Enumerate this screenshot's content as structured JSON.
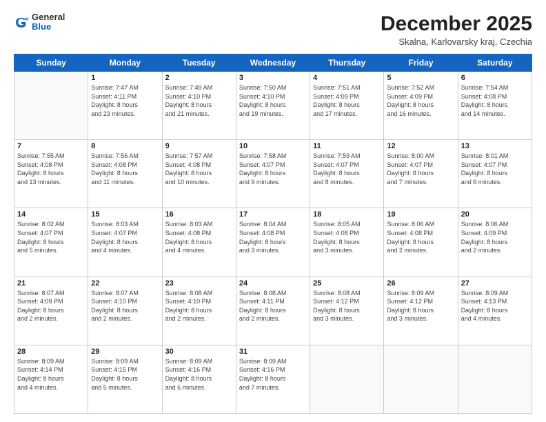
{
  "logo": {
    "general": "General",
    "blue": "Blue"
  },
  "header": {
    "title": "December 2025",
    "subtitle": "Skalna, Karlovarsky kraj, Czechia"
  },
  "days_of_week": [
    "Sunday",
    "Monday",
    "Tuesday",
    "Wednesday",
    "Thursday",
    "Friday",
    "Saturday"
  ],
  "weeks": [
    [
      {
        "day": "",
        "info": ""
      },
      {
        "day": "1",
        "info": "Sunrise: 7:47 AM\nSunset: 4:11 PM\nDaylight: 8 hours\nand 23 minutes."
      },
      {
        "day": "2",
        "info": "Sunrise: 7:49 AM\nSunset: 4:10 PM\nDaylight: 8 hours\nand 21 minutes."
      },
      {
        "day": "3",
        "info": "Sunrise: 7:50 AM\nSunset: 4:10 PM\nDaylight: 8 hours\nand 19 minutes."
      },
      {
        "day": "4",
        "info": "Sunrise: 7:51 AM\nSunset: 4:09 PM\nDaylight: 8 hours\nand 17 minutes."
      },
      {
        "day": "5",
        "info": "Sunrise: 7:52 AM\nSunset: 4:09 PM\nDaylight: 8 hours\nand 16 minutes."
      },
      {
        "day": "6",
        "info": "Sunrise: 7:54 AM\nSunset: 4:08 PM\nDaylight: 8 hours\nand 14 minutes."
      }
    ],
    [
      {
        "day": "7",
        "info": "Sunrise: 7:55 AM\nSunset: 4:08 PM\nDaylight: 8 hours\nand 13 minutes."
      },
      {
        "day": "8",
        "info": "Sunrise: 7:56 AM\nSunset: 4:08 PM\nDaylight: 8 hours\nand 11 minutes."
      },
      {
        "day": "9",
        "info": "Sunrise: 7:57 AM\nSunset: 4:08 PM\nDaylight: 8 hours\nand 10 minutes."
      },
      {
        "day": "10",
        "info": "Sunrise: 7:58 AM\nSunset: 4:07 PM\nDaylight: 8 hours\nand 9 minutes."
      },
      {
        "day": "11",
        "info": "Sunrise: 7:59 AM\nSunset: 4:07 PM\nDaylight: 8 hours\nand 8 minutes."
      },
      {
        "day": "12",
        "info": "Sunrise: 8:00 AM\nSunset: 4:07 PM\nDaylight: 8 hours\nand 7 minutes."
      },
      {
        "day": "13",
        "info": "Sunrise: 8:01 AM\nSunset: 4:07 PM\nDaylight: 8 hours\nand 6 minutes."
      }
    ],
    [
      {
        "day": "14",
        "info": "Sunrise: 8:02 AM\nSunset: 4:07 PM\nDaylight: 8 hours\nand 5 minutes."
      },
      {
        "day": "15",
        "info": "Sunrise: 8:03 AM\nSunset: 4:07 PM\nDaylight: 8 hours\nand 4 minutes."
      },
      {
        "day": "16",
        "info": "Sunrise: 8:03 AM\nSunset: 4:08 PM\nDaylight: 8 hours\nand 4 minutes."
      },
      {
        "day": "17",
        "info": "Sunrise: 8:04 AM\nSunset: 4:08 PM\nDaylight: 8 hours\nand 3 minutes."
      },
      {
        "day": "18",
        "info": "Sunrise: 8:05 AM\nSunset: 4:08 PM\nDaylight: 8 hours\nand 3 minutes."
      },
      {
        "day": "19",
        "info": "Sunrise: 8:06 AM\nSunset: 4:08 PM\nDaylight: 8 hours\nand 2 minutes."
      },
      {
        "day": "20",
        "info": "Sunrise: 8:06 AM\nSunset: 4:09 PM\nDaylight: 8 hours\nand 2 minutes."
      }
    ],
    [
      {
        "day": "21",
        "info": "Sunrise: 8:07 AM\nSunset: 4:09 PM\nDaylight: 8 hours\nand 2 minutes."
      },
      {
        "day": "22",
        "info": "Sunrise: 8:07 AM\nSunset: 4:10 PM\nDaylight: 8 hours\nand 2 minutes."
      },
      {
        "day": "23",
        "info": "Sunrise: 8:08 AM\nSunset: 4:10 PM\nDaylight: 8 hours\nand 2 minutes."
      },
      {
        "day": "24",
        "info": "Sunrise: 8:08 AM\nSunset: 4:11 PM\nDaylight: 8 hours\nand 2 minutes."
      },
      {
        "day": "25",
        "info": "Sunrise: 8:08 AM\nSunset: 4:12 PM\nDaylight: 8 hours\nand 3 minutes."
      },
      {
        "day": "26",
        "info": "Sunrise: 8:09 AM\nSunset: 4:12 PM\nDaylight: 8 hours\nand 3 minutes."
      },
      {
        "day": "27",
        "info": "Sunrise: 8:09 AM\nSunset: 4:13 PM\nDaylight: 8 hours\nand 4 minutes."
      }
    ],
    [
      {
        "day": "28",
        "info": "Sunrise: 8:09 AM\nSunset: 4:14 PM\nDaylight: 8 hours\nand 4 minutes."
      },
      {
        "day": "29",
        "info": "Sunrise: 8:09 AM\nSunset: 4:15 PM\nDaylight: 8 hours\nand 5 minutes."
      },
      {
        "day": "30",
        "info": "Sunrise: 8:09 AM\nSunset: 4:16 PM\nDaylight: 8 hours\nand 6 minutes."
      },
      {
        "day": "31",
        "info": "Sunrise: 8:09 AM\nSunset: 4:16 PM\nDaylight: 8 hours\nand 7 minutes."
      },
      {
        "day": "",
        "info": ""
      },
      {
        "day": "",
        "info": ""
      },
      {
        "day": "",
        "info": ""
      }
    ]
  ]
}
